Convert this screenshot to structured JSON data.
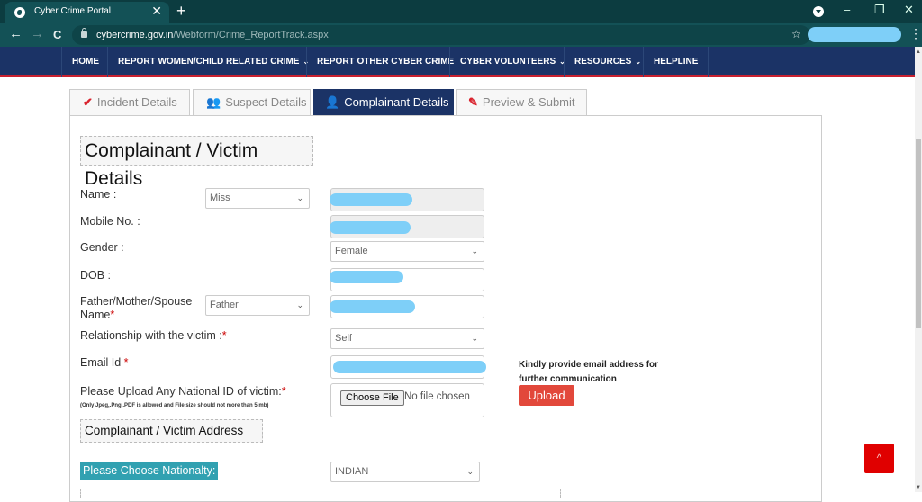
{
  "browser": {
    "tab_title": "Cyber Crime Portal",
    "url_domain": "cybercrime.gov.in",
    "url_path": "/Webform/Crime_ReportTrack.aspx",
    "icons": {
      "new_tab": "+",
      "close_tab": "✕",
      "back": "←",
      "forward": "→",
      "reload": "C",
      "star": "☆",
      "minimize": "–",
      "restore": "❐",
      "close_window": "✕",
      "menu": "⋮"
    }
  },
  "nav": {
    "items": [
      {
        "label": "HOME",
        "dropdown": false
      },
      {
        "label": "REPORT WOMEN/CHILD RELATED CRIME",
        "dropdown": true
      },
      {
        "label": "REPORT OTHER CYBER CRIME",
        "dropdown": false
      },
      {
        "label": "CYBER VOLUNTEERS",
        "dropdown": true
      },
      {
        "label": "RESOURCES",
        "dropdown": true
      },
      {
        "label": "HELPLINE",
        "dropdown": false
      }
    ],
    "chevron": "⌄"
  },
  "tabs": [
    {
      "label": "Incident Details",
      "icon": "✔",
      "icon_color": "#d9232e",
      "active": false
    },
    {
      "label": "Suspect Details",
      "icon": "👥",
      "icon_color": "#d9232e",
      "active": false
    },
    {
      "label": "Complainant Details",
      "icon": "👤",
      "icon_color": "#e53935",
      "active": true
    },
    {
      "label": "Preview & Submit",
      "icon": "✎",
      "icon_color": "#d9232e",
      "active": false
    }
  ],
  "form": {
    "section_title": "Complainant / Victim Details",
    "name_label": "Name :",
    "name_title_select": "Miss",
    "mobile_label": "Mobile No. :",
    "gender_label": "Gender :",
    "gender_select": "Female",
    "dob_label": "DOB :",
    "guardian_label_line1": "Father/Mother/Spouse",
    "guardian_label_line2": "Name",
    "guardian_select": "Father",
    "relationship_label": "Relationship with the victim :",
    "relationship_select": "Self",
    "email_label": "Email Id ",
    "upload_label": "Please Upload Any National ID of victim:",
    "upload_note": "(Only Jpeg,.Png,.PDF is allowed and File size should not more than 5 mb)",
    "choose_file": "Choose File",
    "no_file": "No file chosen",
    "email_hint": "Kindly provide email address for further communication",
    "upload_button": "Upload",
    "required_mark": "*",
    "address_section_title": "Complainant / Victim Address",
    "nationality_label": "Please Choose Nationalty:",
    "nationality_select": "INDIAN"
  },
  "scroll_top_icon": "^"
}
